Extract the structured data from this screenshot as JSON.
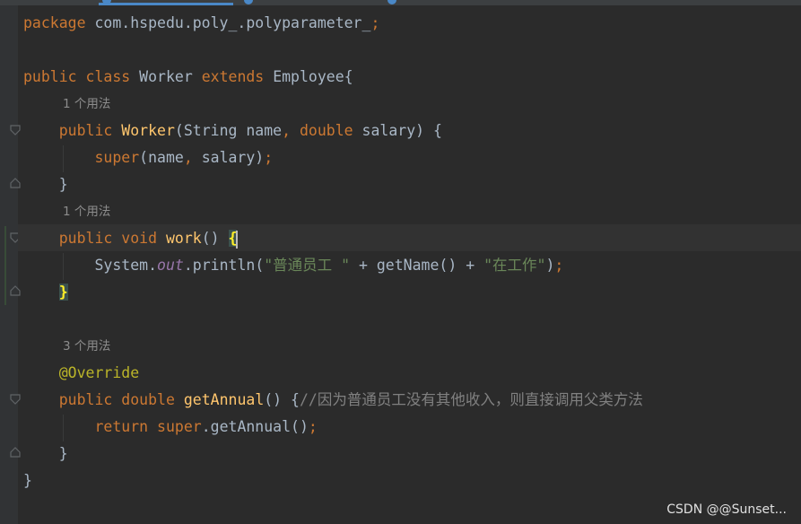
{
  "editor": {
    "line_package": {
      "kw": "package",
      "text": " com.hspedu.poly_.polyparameter_",
      "semi": ";"
    },
    "line_class": {
      "kw1": "public",
      "kw2": "class",
      "name": "Worker",
      "kw3": "extends",
      "parent": "Employee{"
    },
    "hint_constructor": "1 个用法",
    "line_ctor": {
      "kw": "public",
      "fn": "Worker",
      "p1": "(String name",
      "comma": ",",
      "kw2": "double",
      "p2": " salary) {"
    },
    "line_super": {
      "kw": "super",
      "args": "(name",
      "comma": ",",
      "rest": " salary)",
      "semi": ";"
    },
    "line_ctor_close": "}",
    "hint_work": "1 个用法",
    "line_work": {
      "kw1": "public",
      "kw2": "void",
      "fn": "work",
      "parens": "() ",
      "brace": "{"
    },
    "line_println": {
      "obj": "System.",
      "field": "out",
      "mid": ".println(",
      "s1": "\"普通员工 \"",
      "mid2": " + getName() + ",
      "s2": "\"在工作\"",
      "close": ")",
      "semi": ";"
    },
    "line_work_close": "}",
    "hint_annual": "3 个用法",
    "line_override": "@Override",
    "line_annual": {
      "kw1": "public",
      "kw2": "double",
      "fn": "getAnnual",
      "parens": "() {",
      "comment": "//因为普通员工没有其他收入，则直接调用父类方法"
    },
    "line_return": {
      "kw": "return",
      "kw2": "super",
      "call": ".getAnnual()",
      "semi": ";"
    },
    "line_annual_close": "}",
    "line_class_close": "}"
  },
  "watermark": "CSDN @@Sunset...",
  "colors": {
    "background": "#2b2b2b",
    "keyword": "#cc7832",
    "method": "#ffc66d",
    "string": "#6a8759",
    "comment": "#808080",
    "annotation": "#bbb529",
    "default_text": "#a9b7c6"
  }
}
